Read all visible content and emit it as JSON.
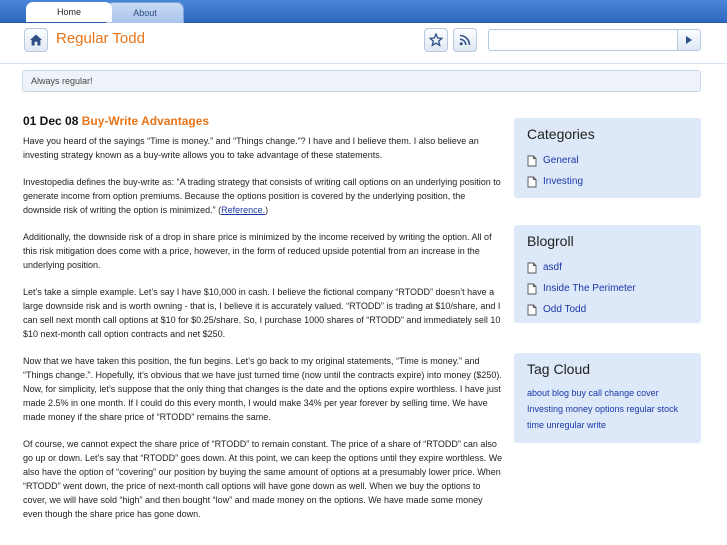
{
  "tabs": [
    {
      "label": "Home"
    },
    {
      "label": "About"
    }
  ],
  "header": {
    "site_title": "Regular Todd",
    "search_placeholder": ""
  },
  "tagline": "Always regular!",
  "post": {
    "date": "01 Dec 08",
    "title": "Buy-Write Advantages",
    "paragraphs": [
      "Have you heard of the sayings “Time is money.” and “Things change.”? I have and I believe them. I also believe an investing strategy known as a buy-write allows you to take advantage of these statements.",
      "Investopedia defines the buy-write as: “A trading strategy that consists of writing call options on an underlying position to generate income from option premiums. Because the options position is covered by the underlying position, the downside risk of writing the option is minimized.” (",
      "Additionally, the downside risk of a drop in share price is minimized by the income received by writing the option.  All of this risk mitigation does come with a price, however, in the form of reduced upside potential from an increase in the underlying position.",
      "Let’s take a simple example. Let’s say I have $10,000 in cash. I believe the fictional company “RTODD” doesn’t have a large downside risk and is worth owning - that is, I believe it is accurately valued. “RTODD” is trading at $10/share, and I can sell next month call options at $10 for $0.25/share. So, I purchase 1000 shares of “RTODD” and immediately sell 10 $10 next-month call option contracts and net $250.",
      "Now that we have taken this position, the fun begins. Let’s go back to my original statements, “Time is money.” and “Things change.”. Hopefully, it’s obvious that we have just turned time (now until the contracts expire) into money ($250). Now, for simplicity, let’s suppose that the only thing that changes is the date and the options expire worthless. I have just made 2.5% in one month. If I could do this every month, I would make 34% per year forever by selling time. We have made money if the share price of “RTODD” remains the same.",
      "Of course, we cannot expect the share price of “RTODD” to remain constant. The price of a share of “RTODD” can also go up or down. Let’s say that “RTODD” goes down. At this point, we can keep the options until they expire worthless. We also have the option of “covering” our position by buying the same amount of options at a presumably lower price. When “RTODD” went down, the price of next-month call options will have gone down as well. When we buy the options to cover, we will have sold “high” and then bought “low” and made money on the options. We have made some money even though the share price has gone down."
    ],
    "reference_link": "Reference.",
    "reference_close": ")"
  },
  "sidebar": {
    "categories": {
      "title": "Categories",
      "items": [
        "General",
        "Investing"
      ]
    },
    "blogroll": {
      "title": "Blogroll",
      "items": [
        "asdf",
        "Inside The Perimeter",
        "Odd Todd"
      ]
    },
    "tagcloud": {
      "title": "Tag Cloud",
      "text": "about blog buy call change cover Investing money options regular stock time unregular write"
    }
  },
  "icons": [
    "home-icon",
    "star-icon",
    "rss-icon",
    "play-icon",
    "page-icon"
  ],
  "colors": {
    "accent": "#e8751a",
    "link": "#1a38a8",
    "tab_bar": "#3b78cf",
    "widget_bg": "#dde9f8"
  }
}
